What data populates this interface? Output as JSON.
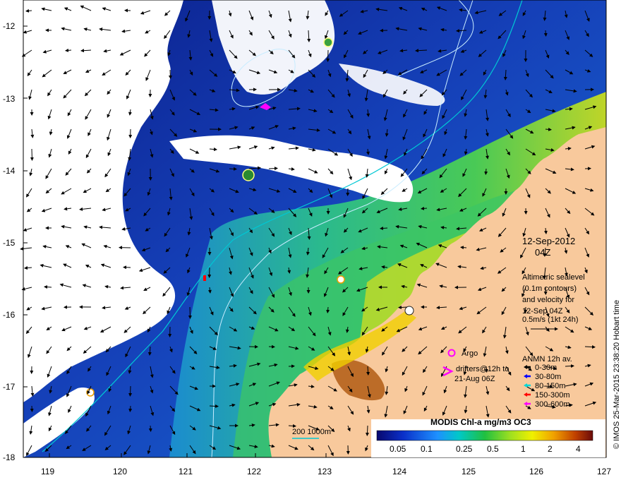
{
  "map": {
    "y_ticks": [
      "-12",
      "-13",
      "-14",
      "-15",
      "-16",
      "-17",
      "-18"
    ],
    "x_ticks": [
      "119",
      "120",
      "121",
      "122",
      "123",
      "124",
      "125",
      "126",
      "127"
    ],
    "date_line1": "12-Sep-2012",
    "date_line2": "04Z",
    "info": [
      "Altimetric sealevel",
      "(0.1m contours)",
      "and velocity for",
      "12-Sep 04Z",
      "0.5m/s (1kt 24h)"
    ],
    "argo_label": "Argo",
    "drifters_line1": "drifters@12h to",
    "drifters_line2": "21-Aug 06Z",
    "anmn_title": "ANMN 12h av.",
    "anmn_items": [
      {
        "label": "0-30m",
        "color": "#000000"
      },
      {
        "label": "30-80m",
        "color": "#0000ff"
      },
      {
        "label": "80-150m",
        "color": "#00d8d8"
      },
      {
        "label": "150-300m",
        "color": "#ff0000"
      },
      {
        "label": "300-600m",
        "color": "#ff00ff"
      }
    ],
    "colorbar_title": "MODIS Chl-a mg/m3 OC3",
    "colorbar_ticks": [
      "0.05",
      "0.1",
      "0.25",
      "0.5",
      "1",
      "2",
      "4"
    ],
    "scale_label": "200  1000m",
    "credit": "© IMOS 25-Mar-2015 23:38:20 Hobart time",
    "colors": {
      "deep_ocean": "#0a1f8f",
      "mid_ocean": "#1d5bd6",
      "shelf_green": "#35c77a",
      "shelf_yellow": "#dcd21a",
      "land": "#f8c99c",
      "cloud": "#ffffff",
      "contour": "#bfe9ff",
      "isobath": "#00c8d4"
    }
  }
}
